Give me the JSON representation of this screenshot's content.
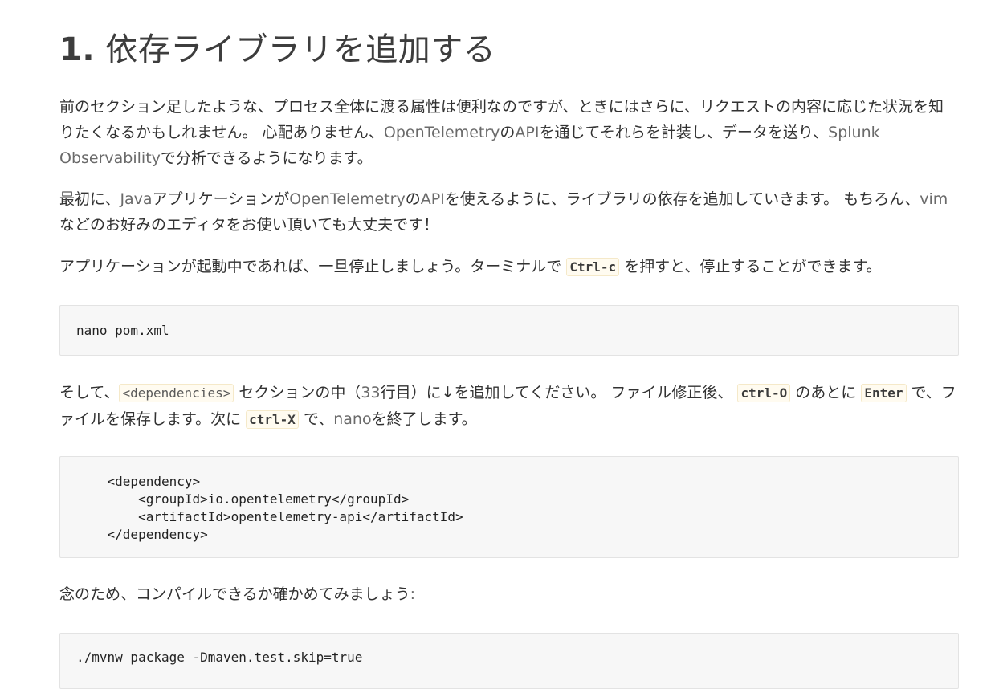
{
  "heading": {
    "number": "1.",
    "text": "依存ライブラリを追加する"
  },
  "para1": {
    "t1": "前のセクション足したような、プロセス全体に渡る属性は便利なのですが、ときにはさらに、リクエストの内容に応じた状況を知りたくなるかもしれません。 心配ありません、",
    "l1": "OpenTelemetry",
    "t2": "の",
    "l2": "API",
    "t3": "を通じてそれらを計装し、データを送り、",
    "l3": "Splunk Observability",
    "t4": "で分析できるようになります。"
  },
  "para2": {
    "t1": "最初に、",
    "l1": "Java",
    "t2": "アプリケーションが",
    "l2": "OpenTelemetry",
    "t3": "の",
    "l3": "API",
    "t4": "を使えるように、ライブラリの依存を追加していきます。 もちろん、",
    "l4": "vim",
    "t5": "などのお好みのエディタをお使い頂いても大丈夫です！"
  },
  "para3": {
    "t1": "アプリケーションが起動中であれば、一旦停止しましょう。ターミナルで ",
    "c1": "Ctrl-c",
    "t2": " を押すと、停止することができます。"
  },
  "code1": "nano pom.xml",
  "para4": {
    "t1": "そして、",
    "c1": "<dependencies>",
    "t2": " セクションの中（",
    "l1": "33",
    "t3": "行目）に↓を追加してください。 ファイル修正後、 ",
    "c2": "ctrl-O",
    "t4": " のあとに ",
    "c3": "Enter",
    "t5": " で、ファイルを保存します。次に ",
    "c4": "ctrl-X",
    "t6": " で、",
    "l2": "nano",
    "t7": "を終了します。"
  },
  "code2": "    <dependency>\n        <groupId>io.opentelemetry</groupId>\n        <artifactId>opentelemetry-api</artifactId>\n    </dependency>",
  "para5": {
    "t1": "念のため、コンパイルできるか確かめてみましょう",
    "l1": ":"
  },
  "code3": "./mvnw package -Dmaven.test.skip=true"
}
